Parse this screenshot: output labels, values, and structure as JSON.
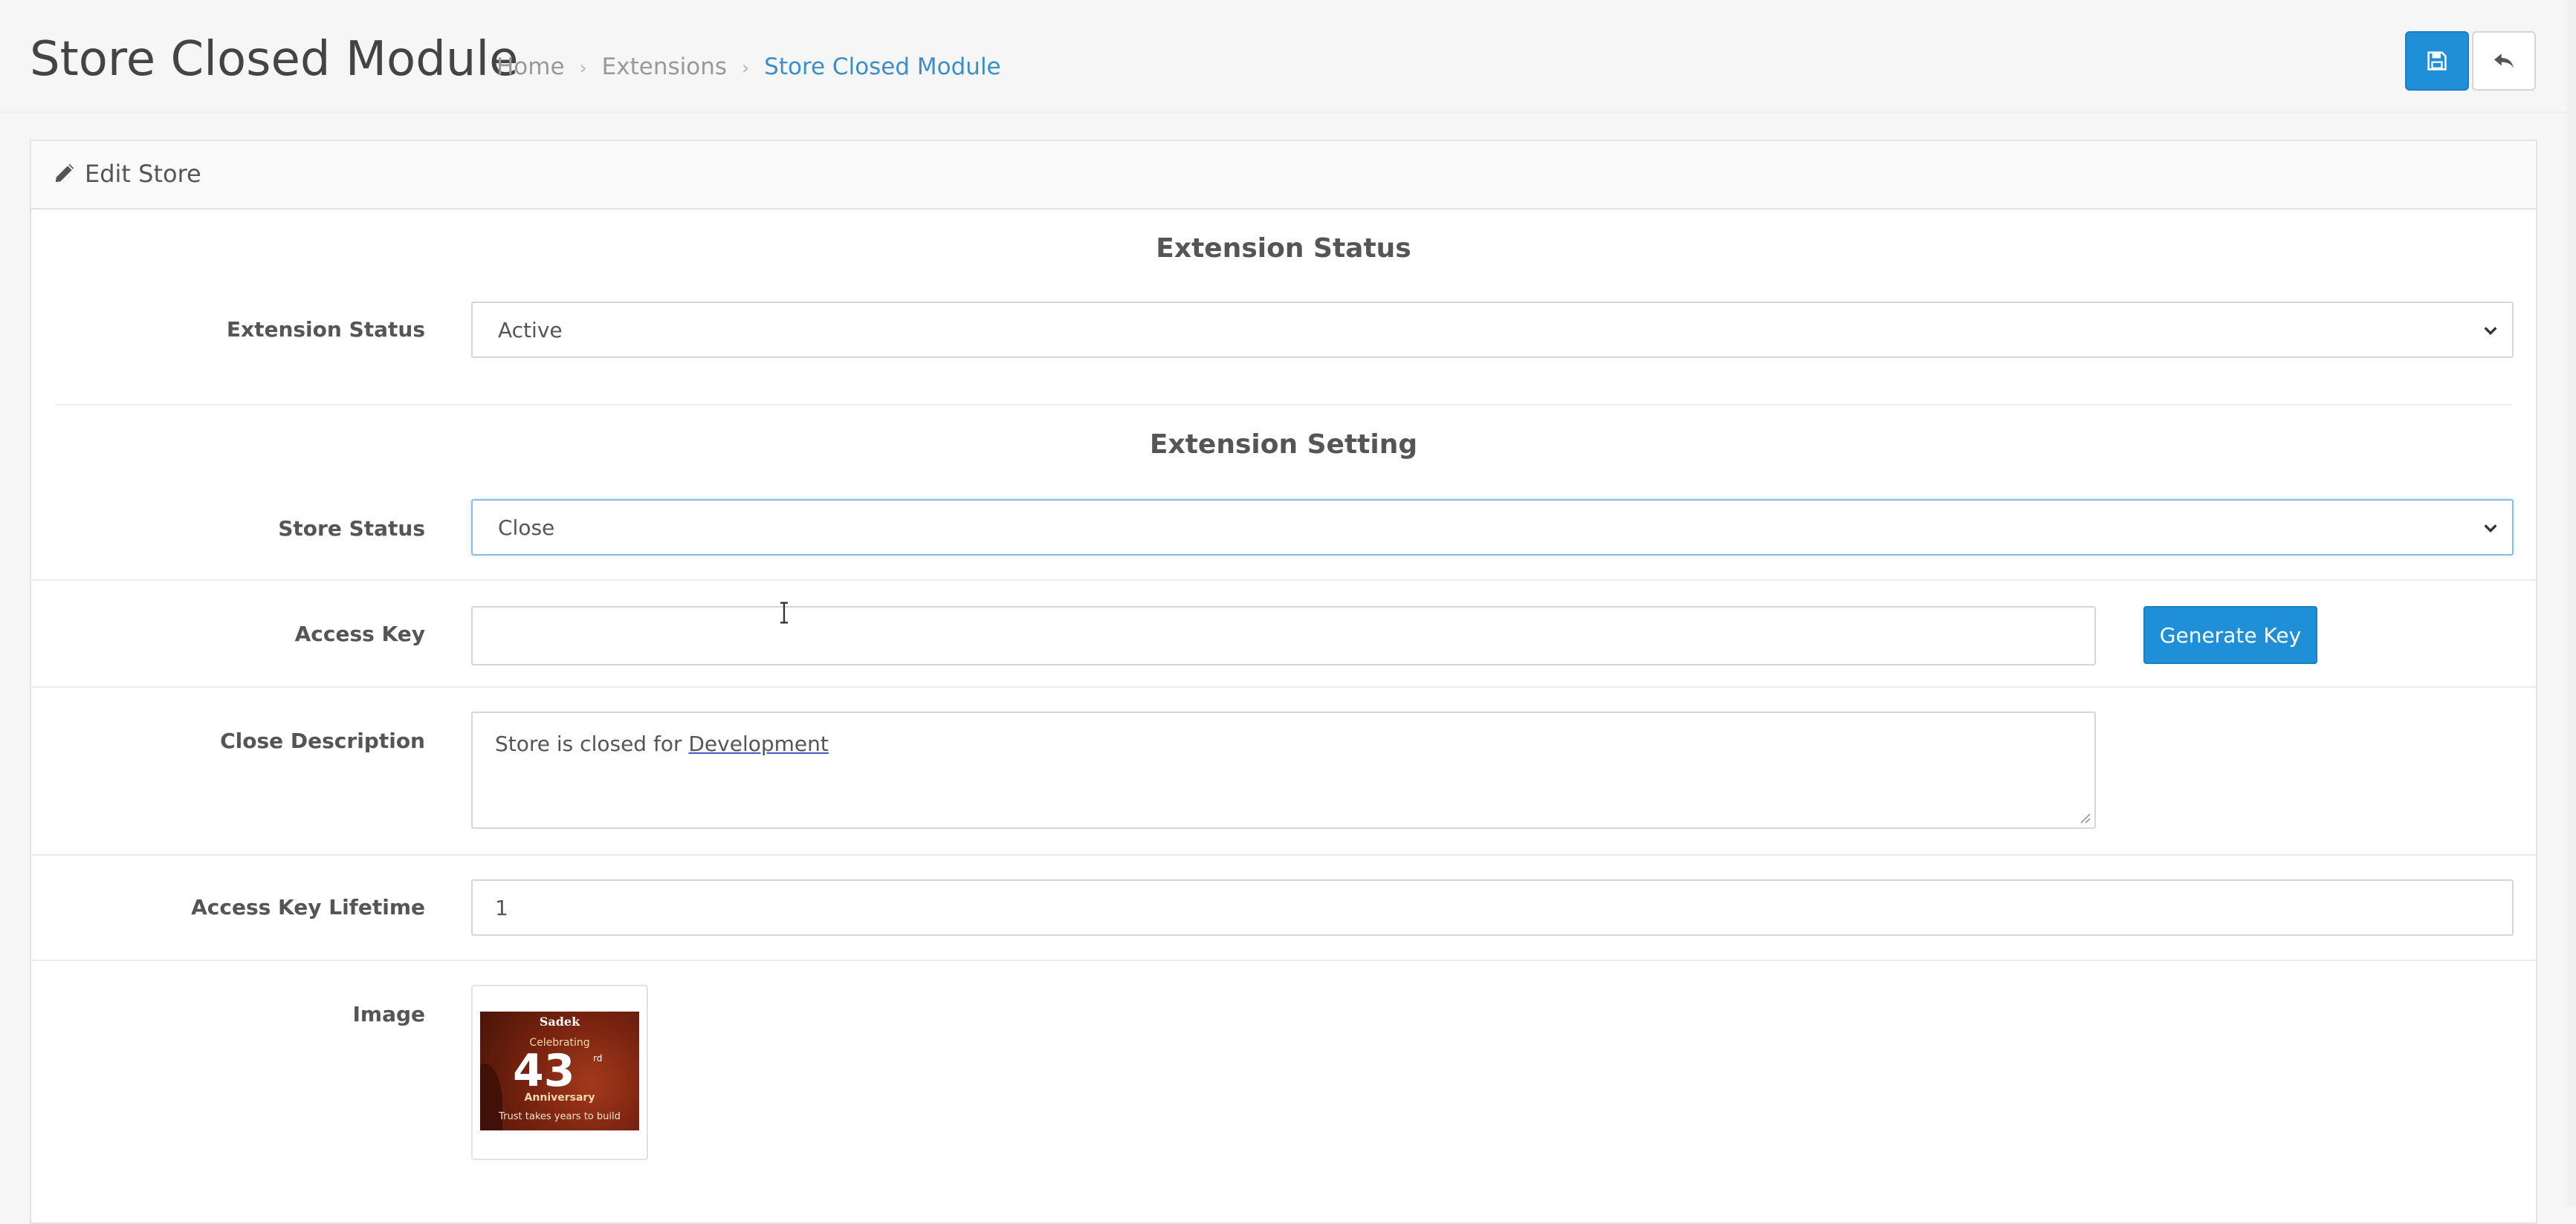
{
  "header": {
    "title": "Store Closed Module",
    "breadcrumb": [
      "Home",
      "Extensions",
      "Store Closed Module"
    ],
    "save_icon": "save-icon",
    "back_icon": "reply-icon"
  },
  "panel": {
    "heading": "Edit Store",
    "heading_icon": "pencil-icon"
  },
  "sections": {
    "status_title": "Extension Status",
    "setting_title": "Extension Setting"
  },
  "form": {
    "extension_status": {
      "label": "Extension Status",
      "value": "Active"
    },
    "store_status": {
      "label": "Store Status",
      "value": "Close"
    },
    "access_key": {
      "label": "Access Key",
      "value": ""
    },
    "generate_key_button": "Generate Key",
    "close_description": {
      "label": "Close Description",
      "text_before": "Store is closed for ",
      "text_word": "Development"
    },
    "access_key_lifetime": {
      "label": "Access Key Lifetime",
      "value": "1"
    },
    "image": {
      "label": "Image",
      "thumb_brand": "Sadek",
      "thumb_celebrating": "Celebrating",
      "thumb_number": "43",
      "thumb_suffix": "rd",
      "thumb_anniversary": "Anniversary",
      "thumb_tagline": "Trust takes years to build"
    }
  },
  "colors": {
    "primary": "#1f90d8",
    "link": "#3b8fc8"
  }
}
